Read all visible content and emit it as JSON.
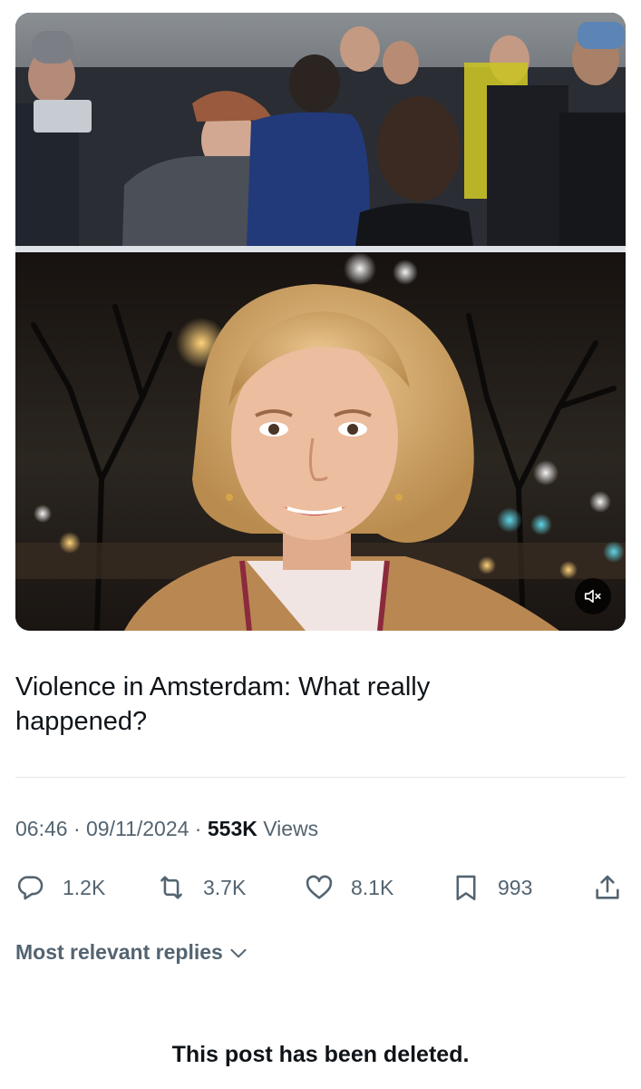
{
  "media": {
    "top_frame_description": "crowd photo",
    "bottom_frame_description": "reporter in front of night city lights",
    "mute_icon": "speaker-muted-icon"
  },
  "post": {
    "text": "Violence in Amsterdam: What really happened?",
    "time": "06:46",
    "separator_1": " · ",
    "date": "09/11/2024",
    "separator_2": " · ",
    "views_count": "553K",
    "views_label": " Views"
  },
  "actions": {
    "replies": {
      "icon": "reply-icon",
      "count": "1.2K"
    },
    "reposts": {
      "icon": "repost-icon",
      "count": "3.7K"
    },
    "likes": {
      "icon": "heart-icon",
      "count": "8.1K"
    },
    "bookmarks": {
      "icon": "bookmark-icon",
      "count": "993"
    },
    "share": {
      "icon": "share-icon"
    }
  },
  "replies_sort": {
    "label": "Most relevant replies",
    "icon": "chevron-down-icon"
  },
  "deleted_notice": "This post has been deleted.",
  "colors": {
    "text_primary": "#0f1419",
    "text_secondary": "#536471",
    "divider": "#e1e6ea"
  }
}
